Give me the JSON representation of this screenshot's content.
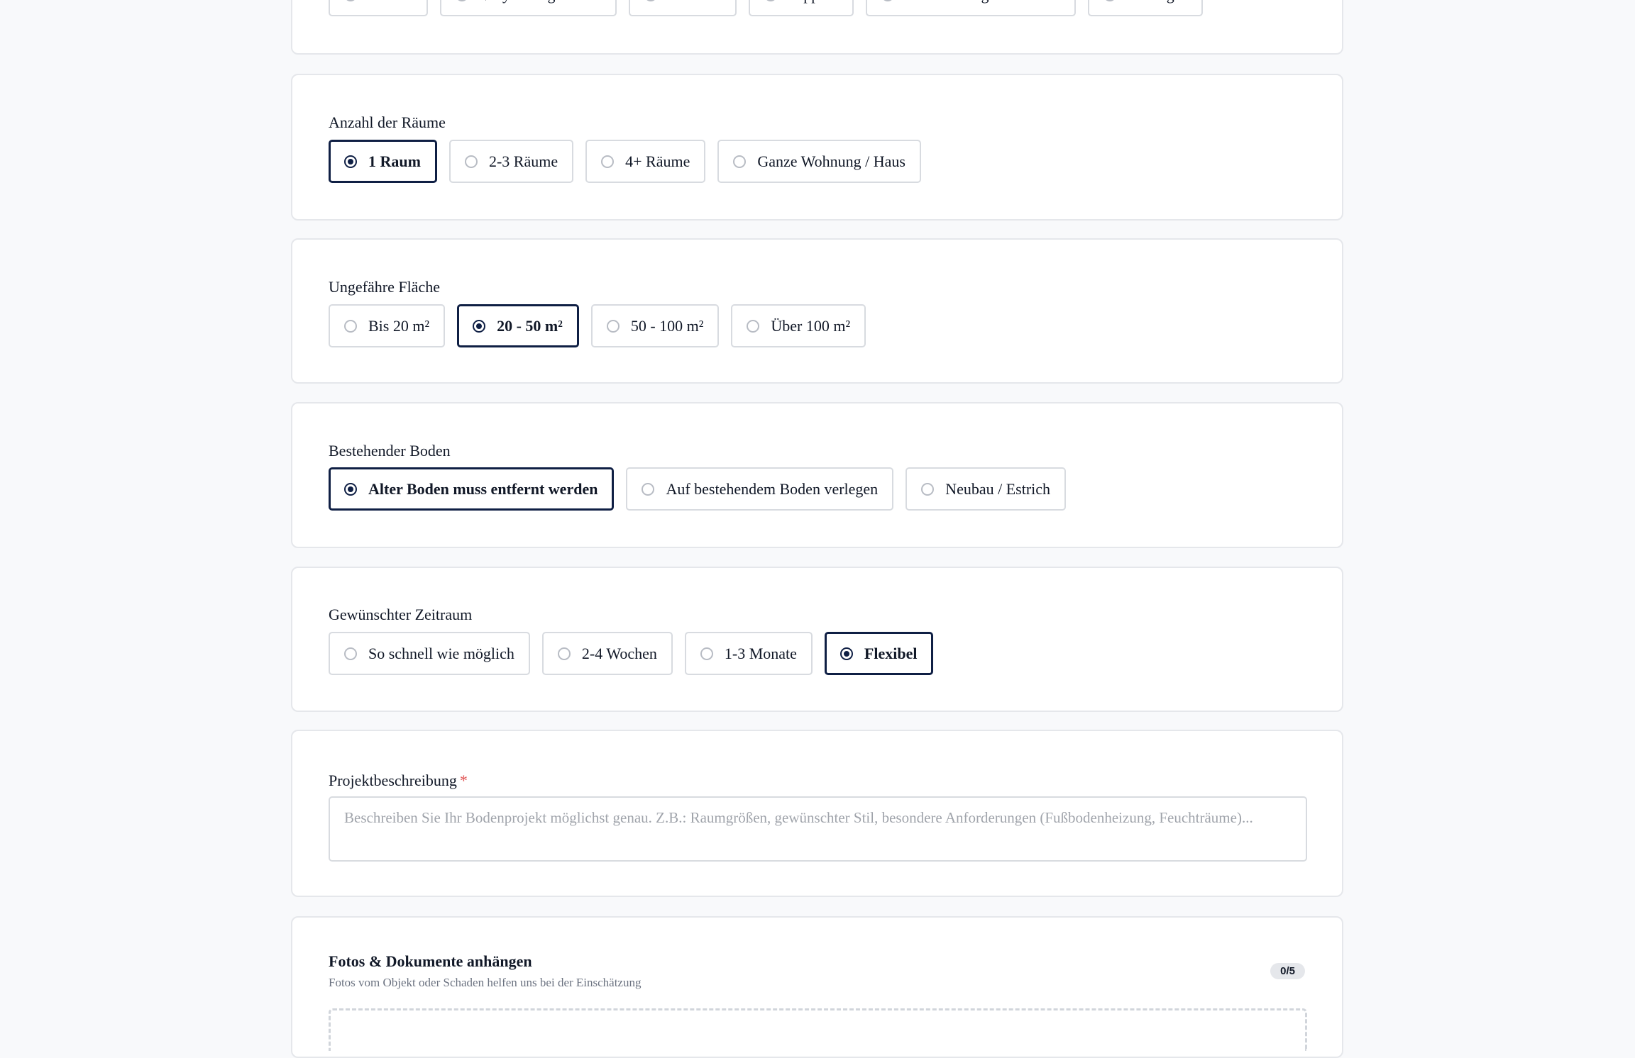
{
  "floor_type": {
    "options": [
      {
        "label": "Parkett",
        "selected": false
      },
      {
        "label": "Vinyl/Designboden",
        "selected": false
      },
      {
        "label": "Laminat",
        "selected": false
      },
      {
        "label": "Teppich",
        "selected": false
      },
      {
        "label": "Aufbereitung / Schleifen",
        "selected": false
      },
      {
        "label": "Sonstiges",
        "selected": false
      }
    ]
  },
  "rooms": {
    "label": "Anzahl der Räume",
    "options": [
      {
        "label": "1 Raum",
        "selected": true
      },
      {
        "label": "2-3 Räume",
        "selected": false
      },
      {
        "label": "4+ Räume",
        "selected": false
      },
      {
        "label": "Ganze Wohnung / Haus",
        "selected": false
      }
    ]
  },
  "area": {
    "label": "Ungefähre Fläche",
    "options": [
      {
        "label": "Bis 20 m²",
        "selected": false
      },
      {
        "label": "20 - 50 m²",
        "selected": true
      },
      {
        "label": "50 - 100 m²",
        "selected": false
      },
      {
        "label": "Über 100 m²",
        "selected": false
      }
    ]
  },
  "existing_floor": {
    "label": "Bestehender Boden",
    "options": [
      {
        "label": "Alter Boden muss entfernt werden",
        "selected": true
      },
      {
        "label": "Auf bestehendem Boden verlegen",
        "selected": false
      },
      {
        "label": "Neubau / Estrich",
        "selected": false
      }
    ]
  },
  "timeframe": {
    "label": "Gewünschter Zeitraum",
    "options": [
      {
        "label": "So schnell wie möglich",
        "selected": false
      },
      {
        "label": "2-4 Wochen",
        "selected": false
      },
      {
        "label": "1-3 Monate",
        "selected": false
      },
      {
        "label": "Flexibel",
        "selected": true
      }
    ]
  },
  "description": {
    "label": "Projektbeschreibung",
    "required_mark": "*",
    "placeholder": "Beschreiben Sie Ihr Bodenprojekt möglichst genau. Z.B.: Raumgrößen, gewünschter Stil, besondere Anforderungen (Fußbodenheizung, Feuchträume)..."
  },
  "attachments": {
    "title": "Fotos & Dokumente anhängen",
    "subtitle": "Fotos vom Objekt oder Schaden helfen uns bei der Einschätzung",
    "counter": "0/5"
  }
}
